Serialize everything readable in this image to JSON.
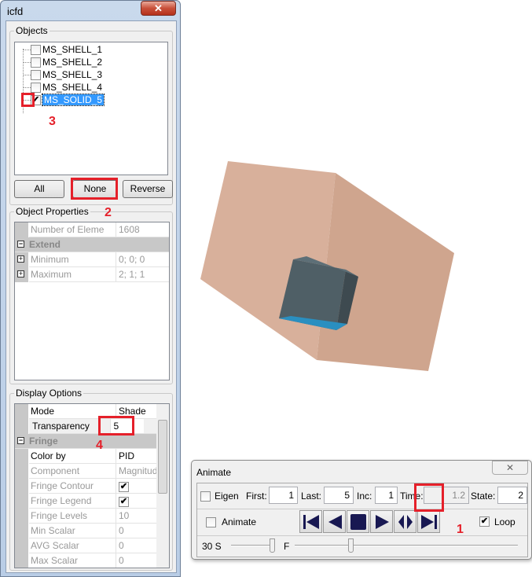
{
  "left_window": {
    "title": "icfd",
    "close": "✕",
    "objects": {
      "label": "Objects",
      "items": [
        {
          "name": "MS_SHELL_1",
          "checked": false
        },
        {
          "name": "MS_SHELL_2",
          "checked": false
        },
        {
          "name": "MS_SHELL_3",
          "checked": false
        },
        {
          "name": "MS_SHELL_4",
          "checked": false
        },
        {
          "name": "MS_SOLID_5",
          "checked": true,
          "selected": true
        }
      ],
      "buttons": {
        "all": "All",
        "none": "None",
        "reverse": "Reverse"
      }
    },
    "object_properties": {
      "label": "Object Properties",
      "rows": [
        {
          "k": "Number of Eleme",
          "v": "1608"
        },
        {
          "k": "Extend",
          "v": ""
        },
        {
          "k": "Minimum",
          "v": "0; 0; 0"
        },
        {
          "k": "Maximum",
          "v": "2; 1; 1"
        }
      ]
    },
    "display_options": {
      "label": "Display Options",
      "rows": [
        {
          "k": "Mode",
          "v": "Shade"
        },
        {
          "k": "Transparency",
          "v": "5"
        },
        {
          "k": "Fringe",
          "v": ""
        },
        {
          "k": "Color by",
          "v": "PID"
        },
        {
          "k": "Component",
          "v": "Magnitude"
        },
        {
          "k": "Fringe Contour",
          "v": "✔"
        },
        {
          "k": "Fringe Legend",
          "v": "✔"
        },
        {
          "k": "Fringe Levels",
          "v": "10"
        },
        {
          "k": "Min Scalar",
          "v": "0"
        },
        {
          "k": "AVG Scalar",
          "v": "0"
        },
        {
          "k": "Max Scalar",
          "v": "0"
        }
      ]
    }
  },
  "annotations": {
    "n1": "1",
    "n2": "2",
    "n3": "3",
    "n4": "4"
  },
  "animate": {
    "title": "Animate",
    "close": "✕",
    "eigen": "Eigen",
    "first_label": "First:",
    "first": "1",
    "last_label": "Last:",
    "last": "5",
    "inc_label": "Inc:",
    "inc": "1",
    "time_label": "Time:",
    "time": "1.2",
    "state_label": "State:",
    "state": "2",
    "animate_label": "Animate",
    "loop_label": "Loop",
    "loop_checked": true,
    "speed_label": "30 S",
    "f_label": "F"
  },
  "colors": {
    "box": "#d4ac96",
    "cube": "#4f5f66",
    "accent": "#e5202a",
    "selection": "#3399ff"
  }
}
